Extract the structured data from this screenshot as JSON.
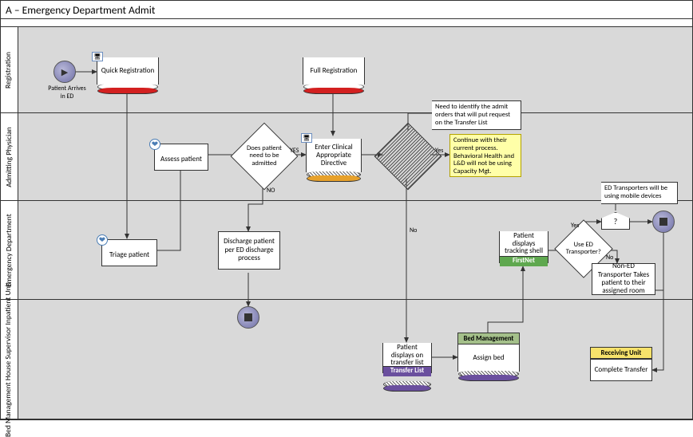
{
  "title": "A – Emergency Department Admit",
  "lanes": {
    "l1": "Registration",
    "l2": "Admitting Physician",
    "l3": "Emergency\nDepartment",
    "l4": "Bed Management\nHouse Supervisor\nInpatient Unit"
  },
  "nodes": {
    "start_label": "Patient Arrives in ED",
    "quick_reg": "Quick Registration",
    "full_reg": "Full Registration",
    "triage": "Triage patient",
    "assess": "Assess patient",
    "dec_admit": "Does patient need to be admitted",
    "enter_directive": "Enter Clinical Appropriate Directive",
    "discharge": "Discharge patient per ED discharge process",
    "note_admit_orders": "Need to identify the admit orders that will put request on the Transfer List",
    "note_continue": "Continue with their current process. Behavioral Health and L&D will not be using Capacity Mgt.",
    "patient_transfer_list": "Patient displays on transfer list",
    "transfer_list_footer": "Transfer List",
    "bed_mgmt_header": "Bed Management",
    "assign_bed": "Assign bed",
    "tracking_shell": "Patient displays tracking shell",
    "firstnet_footer": "FirstNet",
    "dec_transporter": "Use ED Transporter?",
    "pentagon": "?",
    "note_transporters": "ED Transporters will be using mobile devices",
    "non_ed_transport": "Non-ED Transporter Takes patient to their assigned room",
    "receiving_header": "Receiving Unit",
    "complete_transfer": "Complete Transfer"
  },
  "labels": {
    "yes": "YES",
    "yes2": "Yes",
    "no": "NO",
    "no2": "No",
    "nolower": "No"
  }
}
